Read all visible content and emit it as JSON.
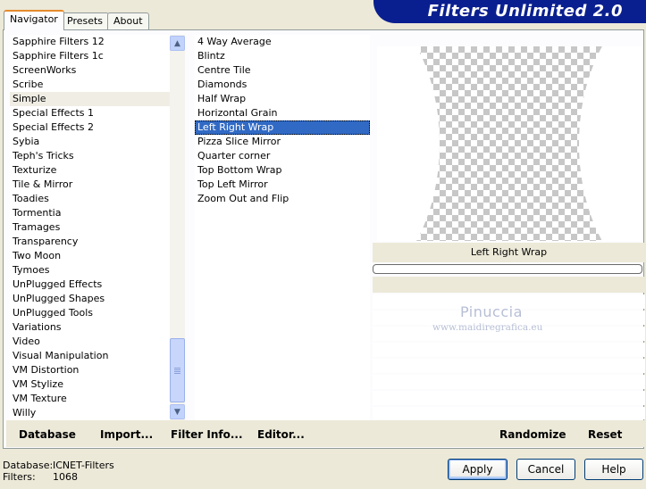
{
  "tabs": [
    {
      "label": "Navigator",
      "active": true
    },
    {
      "label": "Presets",
      "active": false
    },
    {
      "label": "About",
      "active": false
    }
  ],
  "banner_title": "Filters Unlimited 2.0",
  "categories": [
    "Sapphire Filters 12",
    "Sapphire Filters 1c",
    "ScreenWorks",
    "Scribe",
    "Simple",
    "Special Effects 1",
    "Special Effects 2",
    "Sybia",
    "Teph's Tricks",
    "Texturize",
    "Tile & Mirror",
    "Toadies",
    "Tormentia",
    "Tramages",
    "Transparency",
    "Two Moon",
    "Tymoes",
    "UnPlugged Effects",
    "UnPlugged Shapes",
    "UnPlugged Tools",
    "Variations",
    "Video",
    "Visual Manipulation",
    "VM Distortion",
    "VM Stylize",
    "VM Texture",
    "Willy"
  ],
  "selected_category": "Simple",
  "filters": [
    "4 Way Average",
    "Blintz",
    "Centre Tile",
    "Diamonds",
    "Half Wrap",
    "Horizontal Grain",
    "Left Right Wrap",
    "Pizza Slice Mirror",
    "Quarter corner",
    "Top Bottom Wrap",
    "Top Left Mirror",
    "Zoom Out and Flip"
  ],
  "selected_filter": "Left Right Wrap",
  "preview_label": "Left Right Wrap",
  "watermark": {
    "name": "Pinuccia",
    "url": "www.maidiregrafica.eu"
  },
  "bottom_buttons": {
    "database": "Database",
    "import": "Import...",
    "filter_info": "Filter Info...",
    "editor": "Editor...",
    "randomize": "Randomize",
    "reset": "Reset"
  },
  "status": {
    "database_label": "Database:",
    "database_value": "ICNET-Filters",
    "filters_label": "Filters:",
    "filters_value": "1068"
  },
  "dialog_buttons": {
    "apply": "Apply",
    "cancel": "Cancel",
    "help": "Help"
  },
  "icons": {
    "scroll_up": "chevron-up-icon",
    "scroll_down": "chevron-down-icon"
  },
  "colors": {
    "banner": "#0a1f8f",
    "selection": "#316ac5"
  }
}
